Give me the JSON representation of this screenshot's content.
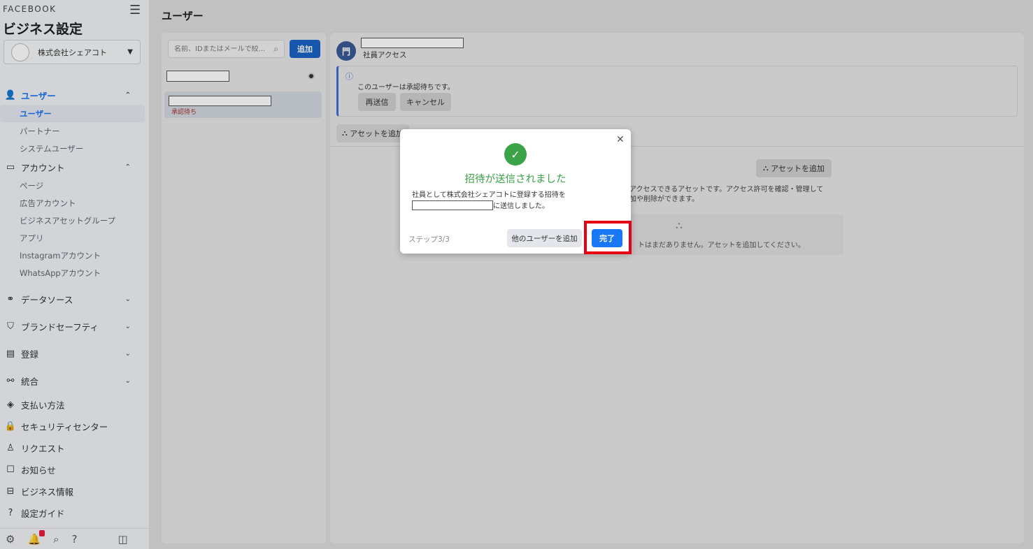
{
  "sidebar": {
    "brand": "FACEBOOK",
    "title": "ビジネス設定",
    "business_name": "株式会社シェアコト",
    "sections": {
      "users": "ユーザー",
      "users_sub": [
        "ユーザー",
        "パートナー",
        "システムユーザー"
      ],
      "accounts": "アカウント",
      "accounts_sub": [
        "ページ",
        "広告アカウント",
        "ビジネスアセットグループ",
        "アプリ",
        "Instagramアカウント",
        "WhatsAppアカウント"
      ],
      "data_sources": "データソース",
      "brand_safety": "ブランドセーフティ",
      "registration": "登録",
      "integrations": "統合",
      "payment": "支払い方法",
      "security": "セキュリティセンター",
      "requests": "リクエスト",
      "notifications": "お知らせ",
      "business_info": "ビジネス情報",
      "setup_guide": "設定ガイド"
    }
  },
  "main": {
    "page_title": "ユーザー",
    "search_placeholder": "名前、IDまたはメールで絞...",
    "add_label": "追加",
    "list_item_status": "承認待ち"
  },
  "detail": {
    "role": "社員アクセス",
    "pending_message": "このユーザーは承認待ちです。",
    "resend": "再送信",
    "cancel": "キャンセル",
    "add_asset": "アセットを追加",
    "asset_desc_line1": "アクセスできるアセットです。アクセス許可を確認・管理して",
    "asset_desc_line2": "加や削除ができます。",
    "empty_text": "トはまだありません。アセットを追加してください。"
  },
  "modal": {
    "title": "招待が送信されました",
    "body_line1": "社員として株式会社シェアコトに登録する招待を",
    "body_line2_suffix": "に送信しました。",
    "step": "ステップ3/3",
    "add_other_user": "他のユーザーを追加",
    "done": "完了"
  },
  "colors": {
    "primary": "#1877f2",
    "success": "#3aa346",
    "highlight": "#e60012"
  }
}
